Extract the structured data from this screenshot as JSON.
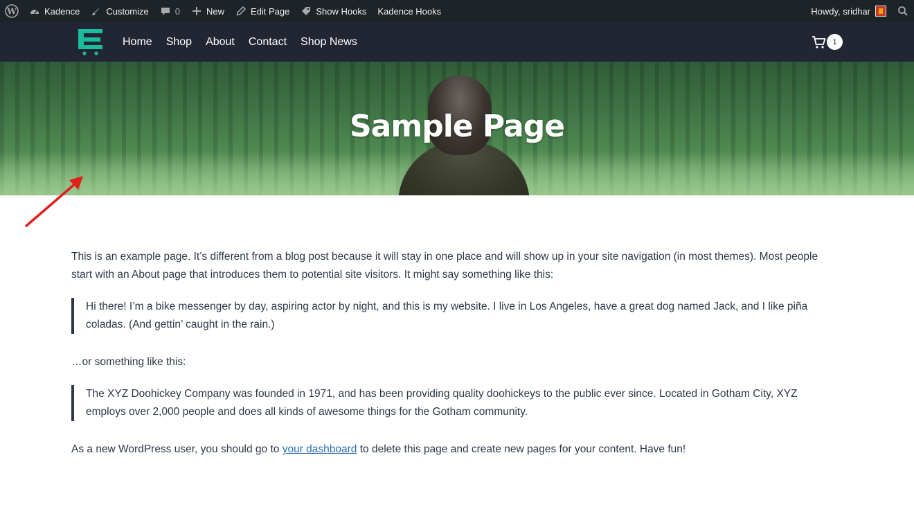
{
  "admin_bar": {
    "wp_logo": "wordpress-icon",
    "site_name": "Kadence",
    "customize": "Customize",
    "comments_count": "0",
    "new": "New",
    "edit_page": "Edit Page",
    "show_hooks": "Show Hooks",
    "kadence_hooks": "Kadence Hooks",
    "howdy": "Howdy, sridhar"
  },
  "header": {
    "nav": [
      "Home",
      "Shop",
      "About",
      "Contact",
      "Shop News"
    ],
    "cart_count": "1"
  },
  "hero": {
    "title": "Sample Page"
  },
  "content": {
    "intro": "This is an example page. It’s different from a blog post because it will stay in one place and will show up in your site navigation (in most themes). Most people start with an About page that introduces them to potential site visitors. It might say something like this:",
    "quote1": "Hi there! I’m a bike messenger by day, aspiring actor by night, and this is my website. I live in Los Angeles, have a great dog named Jack, and I like piña coladas. (And gettin’ caught in the rain.)",
    "middle": "…or something like this:",
    "quote2": "The XYZ Doohickey Company was founded in 1971, and has been providing quality doohickeys to the public ever since. Located in Gotham City, XYZ employs over 2,000 people and does all kinds of awesome things for the Gotham community.",
    "outro_before": "As a new WordPress user, you should go to ",
    "outro_link": "your dashboard",
    "outro_after": " to delete this page and create new pages for your content. Have fun!"
  },
  "colors": {
    "admin_bar": "#1d2327",
    "header": "#222632",
    "logo_accent": "#1abc9c",
    "link": "#2b6cb0",
    "annotation_arrow": "#e0201b"
  }
}
